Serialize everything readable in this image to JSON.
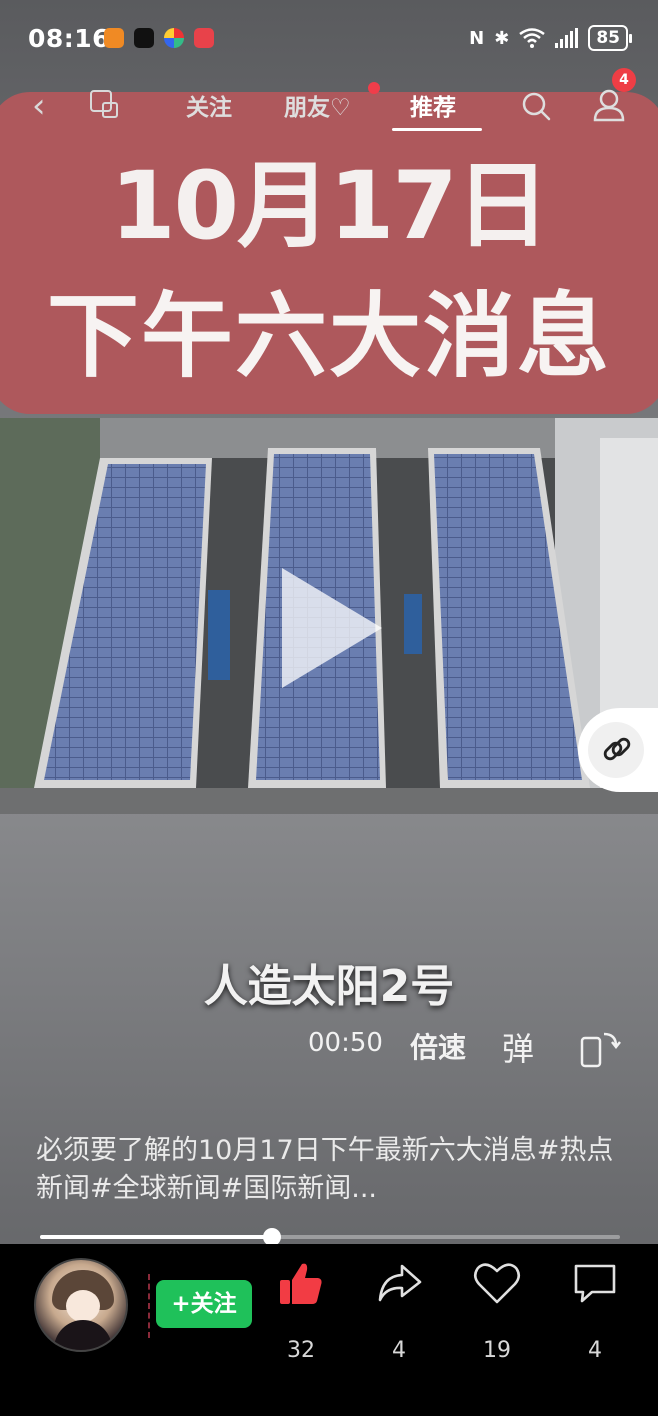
{
  "status_bar": {
    "time": "08:16",
    "battery": "85"
  },
  "nav": {
    "tabs": [
      {
        "label": "关注"
      },
      {
        "label": "朋友♡"
      },
      {
        "label": "推荐"
      }
    ],
    "notification_count": "4"
  },
  "cover": {
    "title_line1": "10月17日",
    "title_line2": "下午六大消息",
    "color": "#ae585c"
  },
  "video": {
    "subtitle": "人造太阳2号",
    "duration": "00:50",
    "speed_label": "倍速",
    "danmu_label": "弹",
    "progress": 0.4
  },
  "caption": "必须要了解的10月17日下午最新六大消息#热点新闻#全球新闻#国际新闻...",
  "bottom": {
    "follow_label": "+关注",
    "likes": "32",
    "shares": "4",
    "favorites": "19",
    "comments": "4",
    "accent": "#1fc15a",
    "like_color": "#f23c44"
  }
}
